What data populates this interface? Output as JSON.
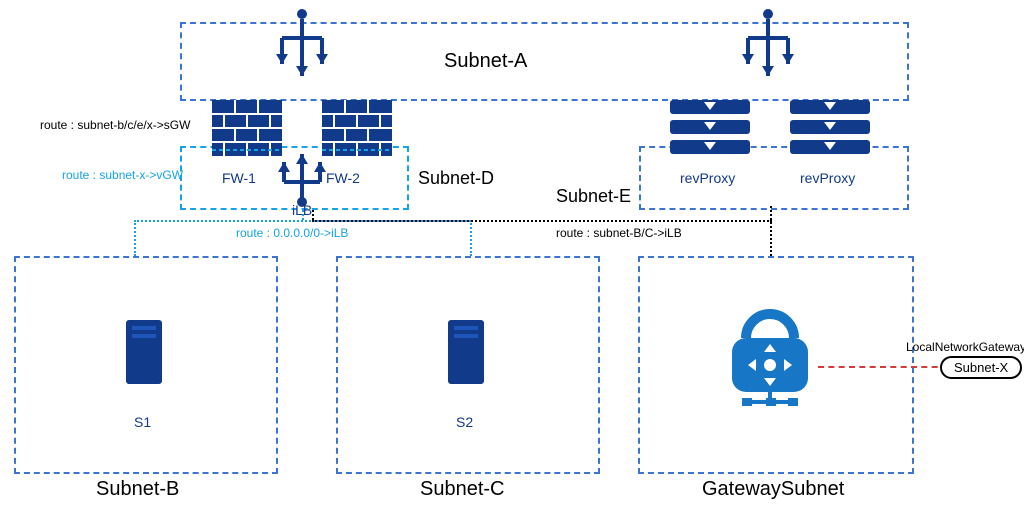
{
  "subnets": {
    "A": {
      "title": "Subnet-A"
    },
    "D": {
      "title": "Subnet-D"
    },
    "E": {
      "title": "Subnet-E"
    },
    "B": {
      "title": "Subnet-B"
    },
    "C": {
      "title": "Subnet-C"
    },
    "G": {
      "title": "GatewaySubnet"
    }
  },
  "firewalls": {
    "fw1": {
      "label": "FW-1"
    },
    "fw2": {
      "label": "FW-2"
    }
  },
  "proxies": {
    "p1": {
      "label": "revProxy"
    },
    "p2": {
      "label": "revProxy"
    }
  },
  "loadBalancers": {
    "ilb": {
      "label": "iLB"
    }
  },
  "servers": {
    "s1": {
      "label": "S1"
    },
    "s2": {
      "label": "S2"
    }
  },
  "routes": {
    "r1": {
      "text": "route : subnet-b/c/e/x->sGW"
    },
    "r2": {
      "text": "route : subnet-x->vGW"
    },
    "r3": {
      "text": "route : 0.0.0.0/0->iLB"
    },
    "r4": {
      "text": "route : subnet-B/C->iLB"
    }
  },
  "external": {
    "gateway": {
      "label": "LocalNetworkGateway"
    },
    "subnetx": {
      "label": "Subnet-X"
    }
  }
}
